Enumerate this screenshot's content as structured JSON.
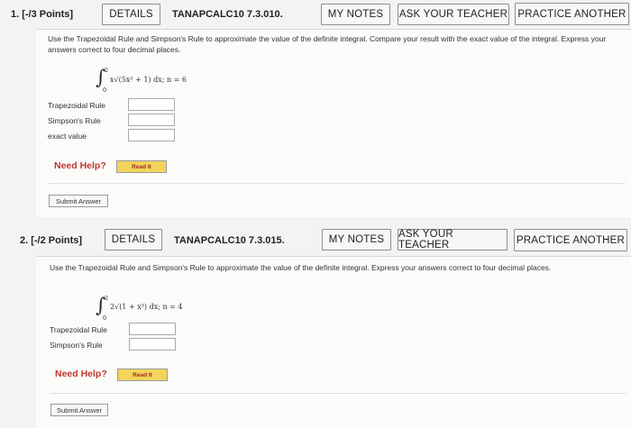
{
  "q1": {
    "header": "1.  [-/3 Points]",
    "details": "DETAILS",
    "code": "TANAPCALC10 7.3.010.",
    "my_notes": "MY NOTES",
    "ask": "ASK YOUR TEACHER",
    "practice": "PRACTICE ANOTHER",
    "prompt": "Use the Trapezoidal Rule and Simpson's Rule to approximate the value of the definite integral. Compare your result with the exact value of the integral. Express your answers correct to four decimal places.",
    "integral": {
      "lower": "0",
      "upper": "2",
      "integrand": "x√(5x² + 1) dx;  n = 6"
    },
    "rows": [
      {
        "label": "Trapezoidal Rule",
        "value": ""
      },
      {
        "label": "Simpson's Rule",
        "value": ""
      },
      {
        "label": "exact value",
        "value": ""
      }
    ],
    "need_help": "Need Help?",
    "read_it": "Read It",
    "submit": "Submit Answer"
  },
  "q2": {
    "header": "2.  [-/2 Points]",
    "details": "DETAILS",
    "code": "TANAPCALC10 7.3.015.",
    "my_notes": "MY NOTES",
    "ask": "ASK YOUR TEACHER",
    "practice": "PRACTICE ANOTHER",
    "prompt": "Use the Trapezoidal Rule and Simpson's Rule to approximate the value of the definite integral. Express your answers correct to four decimal places.",
    "integral": {
      "lower": "0",
      "upper": "2",
      "integrand": "2√(1 + x³) dx;  n = 4"
    },
    "rows": [
      {
        "label": "Trapezoidal Rule",
        "value": ""
      },
      {
        "label": "Simpson's Rule",
        "value": ""
      }
    ],
    "need_help": "Need Help?",
    "read_it": "Read It",
    "submit": "Submit Answer"
  }
}
